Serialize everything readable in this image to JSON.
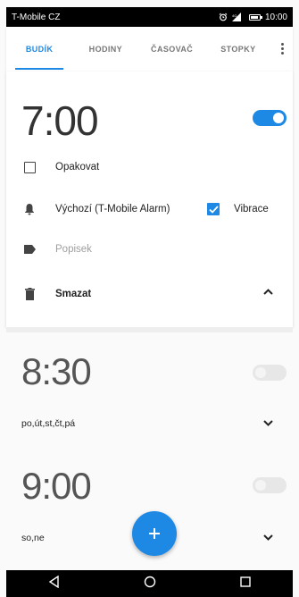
{
  "status_bar": {
    "carrier": "T-Mobile CZ",
    "time": "10:00"
  },
  "tabs": [
    {
      "label": "BUDÍK",
      "active": true
    },
    {
      "label": "HODINY",
      "active": false
    },
    {
      "label": "ČASOVAČ",
      "active": false
    },
    {
      "label": "STOPKY",
      "active": false
    }
  ],
  "accent_color": "#1e88e5",
  "alarms": [
    {
      "time": "7:00",
      "enabled": true,
      "expanded": true,
      "repeat_label": "Opakovat",
      "ringtone": "Výchozí (T-Mobile Alarm)",
      "vibrate_label": "Vibrace",
      "vibrate": true,
      "label_placeholder": "Popisek",
      "delete_label": "Smazat"
    },
    {
      "time": "8:30",
      "enabled": false,
      "days": "po,út,st,čt,pá"
    },
    {
      "time": "9:00",
      "enabled": false,
      "days": "so,ne"
    }
  ],
  "fab_icon": "add-icon",
  "nav": {
    "back": "back-icon",
    "home": "home-icon",
    "recents": "recents-icon"
  }
}
